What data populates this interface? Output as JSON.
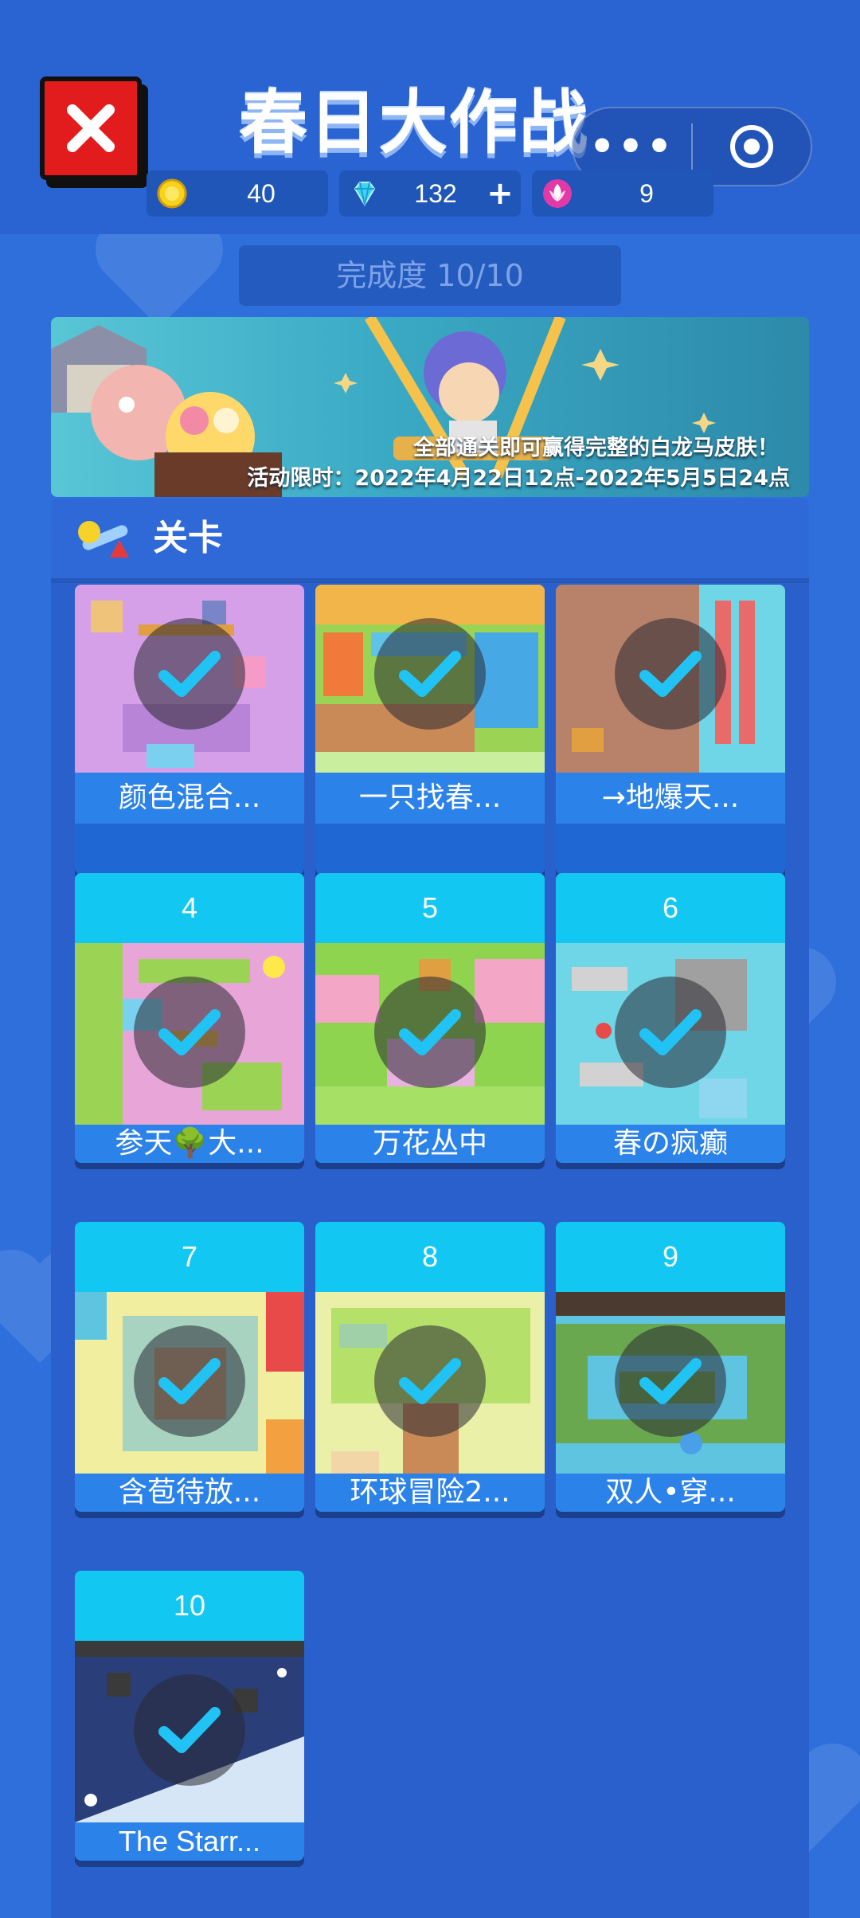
{
  "header": {
    "title": "春日大作战",
    "capsule_more": "•••",
    "resources": [
      {
        "icon": "coin-icon",
        "value": "40"
      },
      {
        "icon": "diamond-icon",
        "value": "132",
        "action": "+"
      },
      {
        "icon": "flower-icon",
        "value": "9"
      }
    ]
  },
  "progress": {
    "label": "完成度 10/10"
  },
  "banner": {
    "line1": "全部通关即可赢得完整的白龙马皮肤！",
    "line2": "活动限时：2022年4月22日12点-2022年5月5日24点"
  },
  "levels": {
    "title": "关卡",
    "items": [
      {
        "number": "",
        "name": "颜色混合...",
        "completed": true,
        "theme": "#d6a0e8"
      },
      {
        "number": "",
        "name": "一只找春...",
        "completed": true,
        "theme": "#9bd455"
      },
      {
        "number": "",
        "name": "→地爆天...",
        "completed": true,
        "theme": "#b8826a"
      },
      {
        "number": "4",
        "name": "参天🌳大...",
        "completed": true,
        "theme": "#e8a6d8"
      },
      {
        "number": "5",
        "name": "万花丛中",
        "completed": true,
        "theme": "#8fd44f"
      },
      {
        "number": "6",
        "name": "春の疯癫",
        "completed": true,
        "theme": "#6fd6e8"
      },
      {
        "number": "7",
        "name": "含苞待放...",
        "completed": true,
        "theme": "#f1eea0"
      },
      {
        "number": "8",
        "name": "环球冒险2...",
        "completed": true,
        "theme": "#b5e06a"
      },
      {
        "number": "9",
        "name": "双人•穿...",
        "completed": true,
        "theme": "#5fc4e0"
      },
      {
        "number": "10",
        "name": "The Starr...",
        "completed": true,
        "theme": "#2a3f7a"
      }
    ]
  },
  "colors": {
    "background": "#2e6fdc",
    "accent": "#12c7f2",
    "check": "#20c3f4",
    "close": "#e21c1c"
  }
}
